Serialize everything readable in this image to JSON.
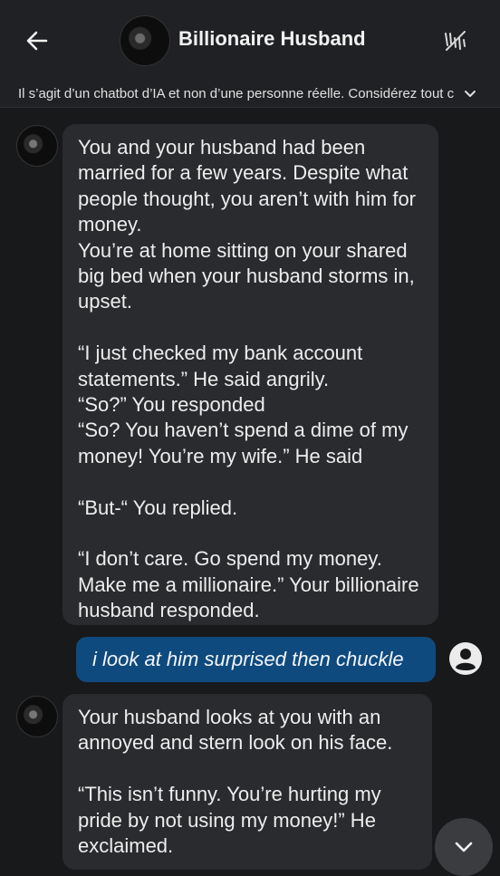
{
  "header": {
    "title": "Billionaire Husband",
    "icons": {
      "back": "arrow-left-icon",
      "clear": "broom-icon"
    }
  },
  "disclaimer": {
    "text": "Il s’agit d’un chatbot d’IA et non d’une personne réelle. Considérez tout c",
    "icon": "chevron-down-icon"
  },
  "messages": {
    "bot1": {
      "p1": "You and your husband had been married for a few years. Despite what people thought, you aren’t with him for money.",
      "p1b": "You’re at home sitting on your shared big bed when your husband storms in, upset.",
      "p2a": "“I just checked my bank account statements.” He said angrily.",
      "p2b": "“So?” You responded",
      "p2c": "“So? You haven’t spend a dime of my money! You’re my wife.” He said",
      "p3": "“But-“ You replied.",
      "p4": "“I don’t care. Go spend my money. Make me a millionaire.” Your billionaire husband responded."
    },
    "user1": "i look at him surprised then chuckle",
    "bot2": {
      "p1": "Your husband looks at you with an annoyed and stern look on his face.",
      "p2": "“This isn’t funny. You’re hurting my pride by not using my money!” He exclaimed."
    }
  },
  "fab": {
    "icon": "chevron-down-icon"
  },
  "colors": {
    "user_bubble": "#0f4a7e",
    "bot_bubble": "#2a2b2e",
    "background": "#18191b"
  }
}
